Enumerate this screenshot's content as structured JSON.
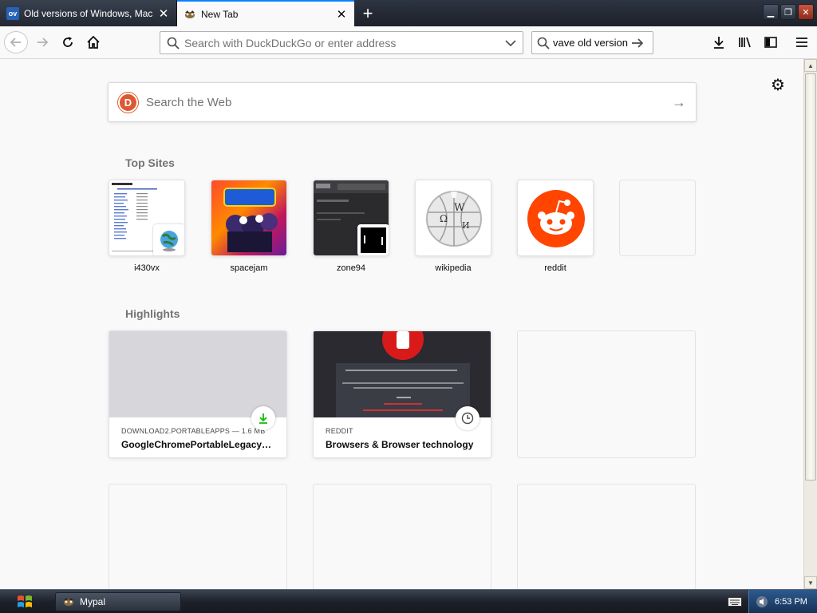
{
  "browser": {
    "tabs": [
      {
        "title": "Old versions of Windows, Mac and",
        "favicon_text": "ov",
        "active": false
      },
      {
        "title": "New Tab",
        "favicon_text": "",
        "active": true
      }
    ],
    "url_placeholder": "Search with DuckDuckGo or enter address",
    "search_bar_value": "vave old version"
  },
  "newtab": {
    "web_search_placeholder": "Search the Web",
    "top_sites_title": "Top Sites",
    "top_sites": [
      {
        "label": "i430vx"
      },
      {
        "label": "spacejam"
      },
      {
        "label": "zone94"
      },
      {
        "label": "wikipedia"
      },
      {
        "label": "reddit"
      },
      {
        "label": ""
      }
    ],
    "highlights_title": "Highlights",
    "highlights": [
      {
        "source": "DOWNLOAD2.PORTABLEAPPS — 1.6 MB",
        "title": "GoogleChromePortableLegacyW...",
        "icon": "download-icon"
      },
      {
        "source": "REDDIT",
        "title": "Browsers & Browser technology",
        "icon": "clock-icon"
      }
    ]
  },
  "taskbar": {
    "task_label": "Mypal",
    "clock": "6:53 PM"
  },
  "colors": {
    "accent": "#0a84ff",
    "reddit": "#ff4500",
    "duckduckgo": "#de5833",
    "download_green": "#12bc00"
  }
}
